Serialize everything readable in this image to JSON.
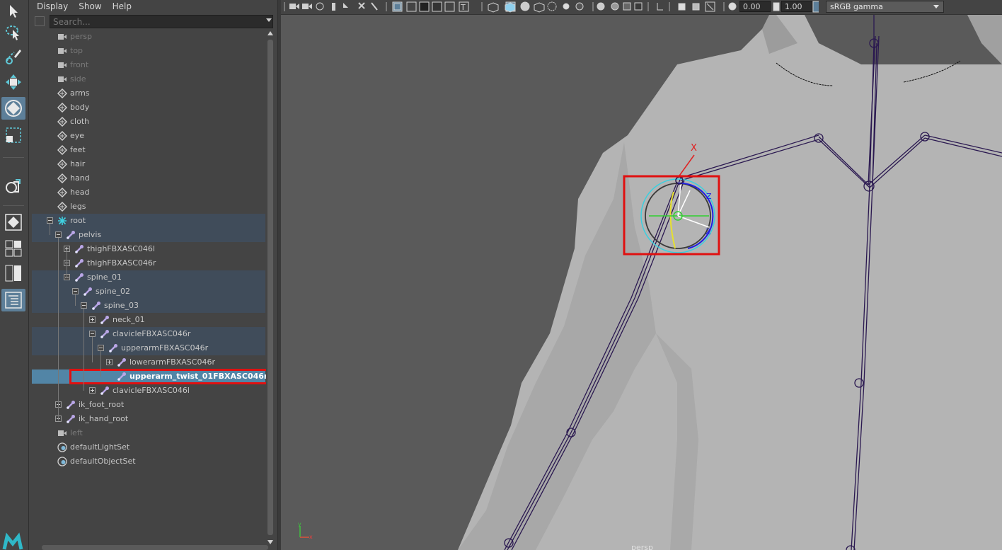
{
  "outliner": {
    "menus": [
      "Display",
      "Show",
      "Help"
    ],
    "search_placeholder": "Search...",
    "items": [
      {
        "label": "persp",
        "kind": "camera",
        "depth": 0,
        "dim": true
      },
      {
        "label": "top",
        "kind": "camera",
        "depth": 0,
        "dim": true
      },
      {
        "label": "front",
        "kind": "camera",
        "depth": 0,
        "dim": true
      },
      {
        "label": "side",
        "kind": "camera",
        "depth": 0,
        "dim": true
      },
      {
        "label": "arms",
        "kind": "mesh",
        "depth": 0
      },
      {
        "label": "body",
        "kind": "mesh",
        "depth": 0
      },
      {
        "label": "cloth",
        "kind": "mesh",
        "depth": 0
      },
      {
        "label": "eye",
        "kind": "mesh",
        "depth": 0
      },
      {
        "label": "feet",
        "kind": "mesh",
        "depth": 0
      },
      {
        "label": "hair",
        "kind": "mesh",
        "depth": 0
      },
      {
        "label": "hand",
        "kind": "mesh",
        "depth": 0
      },
      {
        "label": "head",
        "kind": "mesh",
        "depth": 0
      },
      {
        "label": "legs",
        "kind": "mesh",
        "depth": 0
      },
      {
        "label": "root",
        "kind": "root",
        "depth": 0,
        "band": true,
        "expander": "minus"
      },
      {
        "label": "pelvis",
        "kind": "joint",
        "depth": 1,
        "band": true,
        "expander": "minus"
      },
      {
        "label": "thighFBXASC046l",
        "kind": "joint",
        "depth": 2,
        "expander": "plus"
      },
      {
        "label": "thighFBXASC046r",
        "kind": "joint",
        "depth": 2,
        "expander": "plus"
      },
      {
        "label": "spine_01",
        "kind": "joint",
        "depth": 2,
        "band": true,
        "expander": "minus"
      },
      {
        "label": "spine_02",
        "kind": "joint",
        "depth": 3,
        "band": true,
        "expander": "minus"
      },
      {
        "label": "spine_03",
        "kind": "joint",
        "depth": 4,
        "band": true,
        "expander": "minus"
      },
      {
        "label": "neck_01",
        "kind": "joint",
        "depth": 5,
        "expander": "plus"
      },
      {
        "label": "clavicleFBXASC046r",
        "kind": "joint",
        "depth": 5,
        "band": true,
        "expander": "minus"
      },
      {
        "label": "upperarmFBXASC046r",
        "kind": "joint",
        "depth": 6,
        "band": true,
        "expander": "minus"
      },
      {
        "label": "lowerarmFBXASC046r",
        "kind": "joint",
        "depth": 7,
        "expander": "plus"
      },
      {
        "label": "upperarm_twist_01FBXASC046r",
        "kind": "joint",
        "depth": 7,
        "selected": true
      },
      {
        "label": "clavicleFBXASC046l",
        "kind": "joint",
        "depth": 5,
        "expander": "plus"
      },
      {
        "label": "ik_foot_root",
        "kind": "joint",
        "depth": 1,
        "expander": "plus"
      },
      {
        "label": "ik_hand_root",
        "kind": "joint",
        "depth": 1,
        "expander": "plus"
      },
      {
        "label": "left",
        "kind": "camera",
        "depth": 0,
        "dim": true
      },
      {
        "label": "defaultLightSet",
        "kind": "set",
        "depth": 0
      },
      {
        "label": "defaultObjectSet",
        "kind": "set",
        "depth": 0
      }
    ]
  },
  "viewport": {
    "exposure": "0.00",
    "gamma": "1.00",
    "color_space": "sRGB gamma",
    "camera_label": "persp",
    "manipulator_axis_x": "X",
    "manipulator_axis_z1": "Z",
    "manipulator_axis_z2": "Z",
    "axis_y": "y",
    "axis_x": "x"
  },
  "colors": {
    "selection": "#5285a6",
    "hierarchy_band": "#404c5a",
    "highlight_box": "#e01010",
    "joint_icon": "#b9a6e6",
    "bone_line": "#2a1850"
  }
}
